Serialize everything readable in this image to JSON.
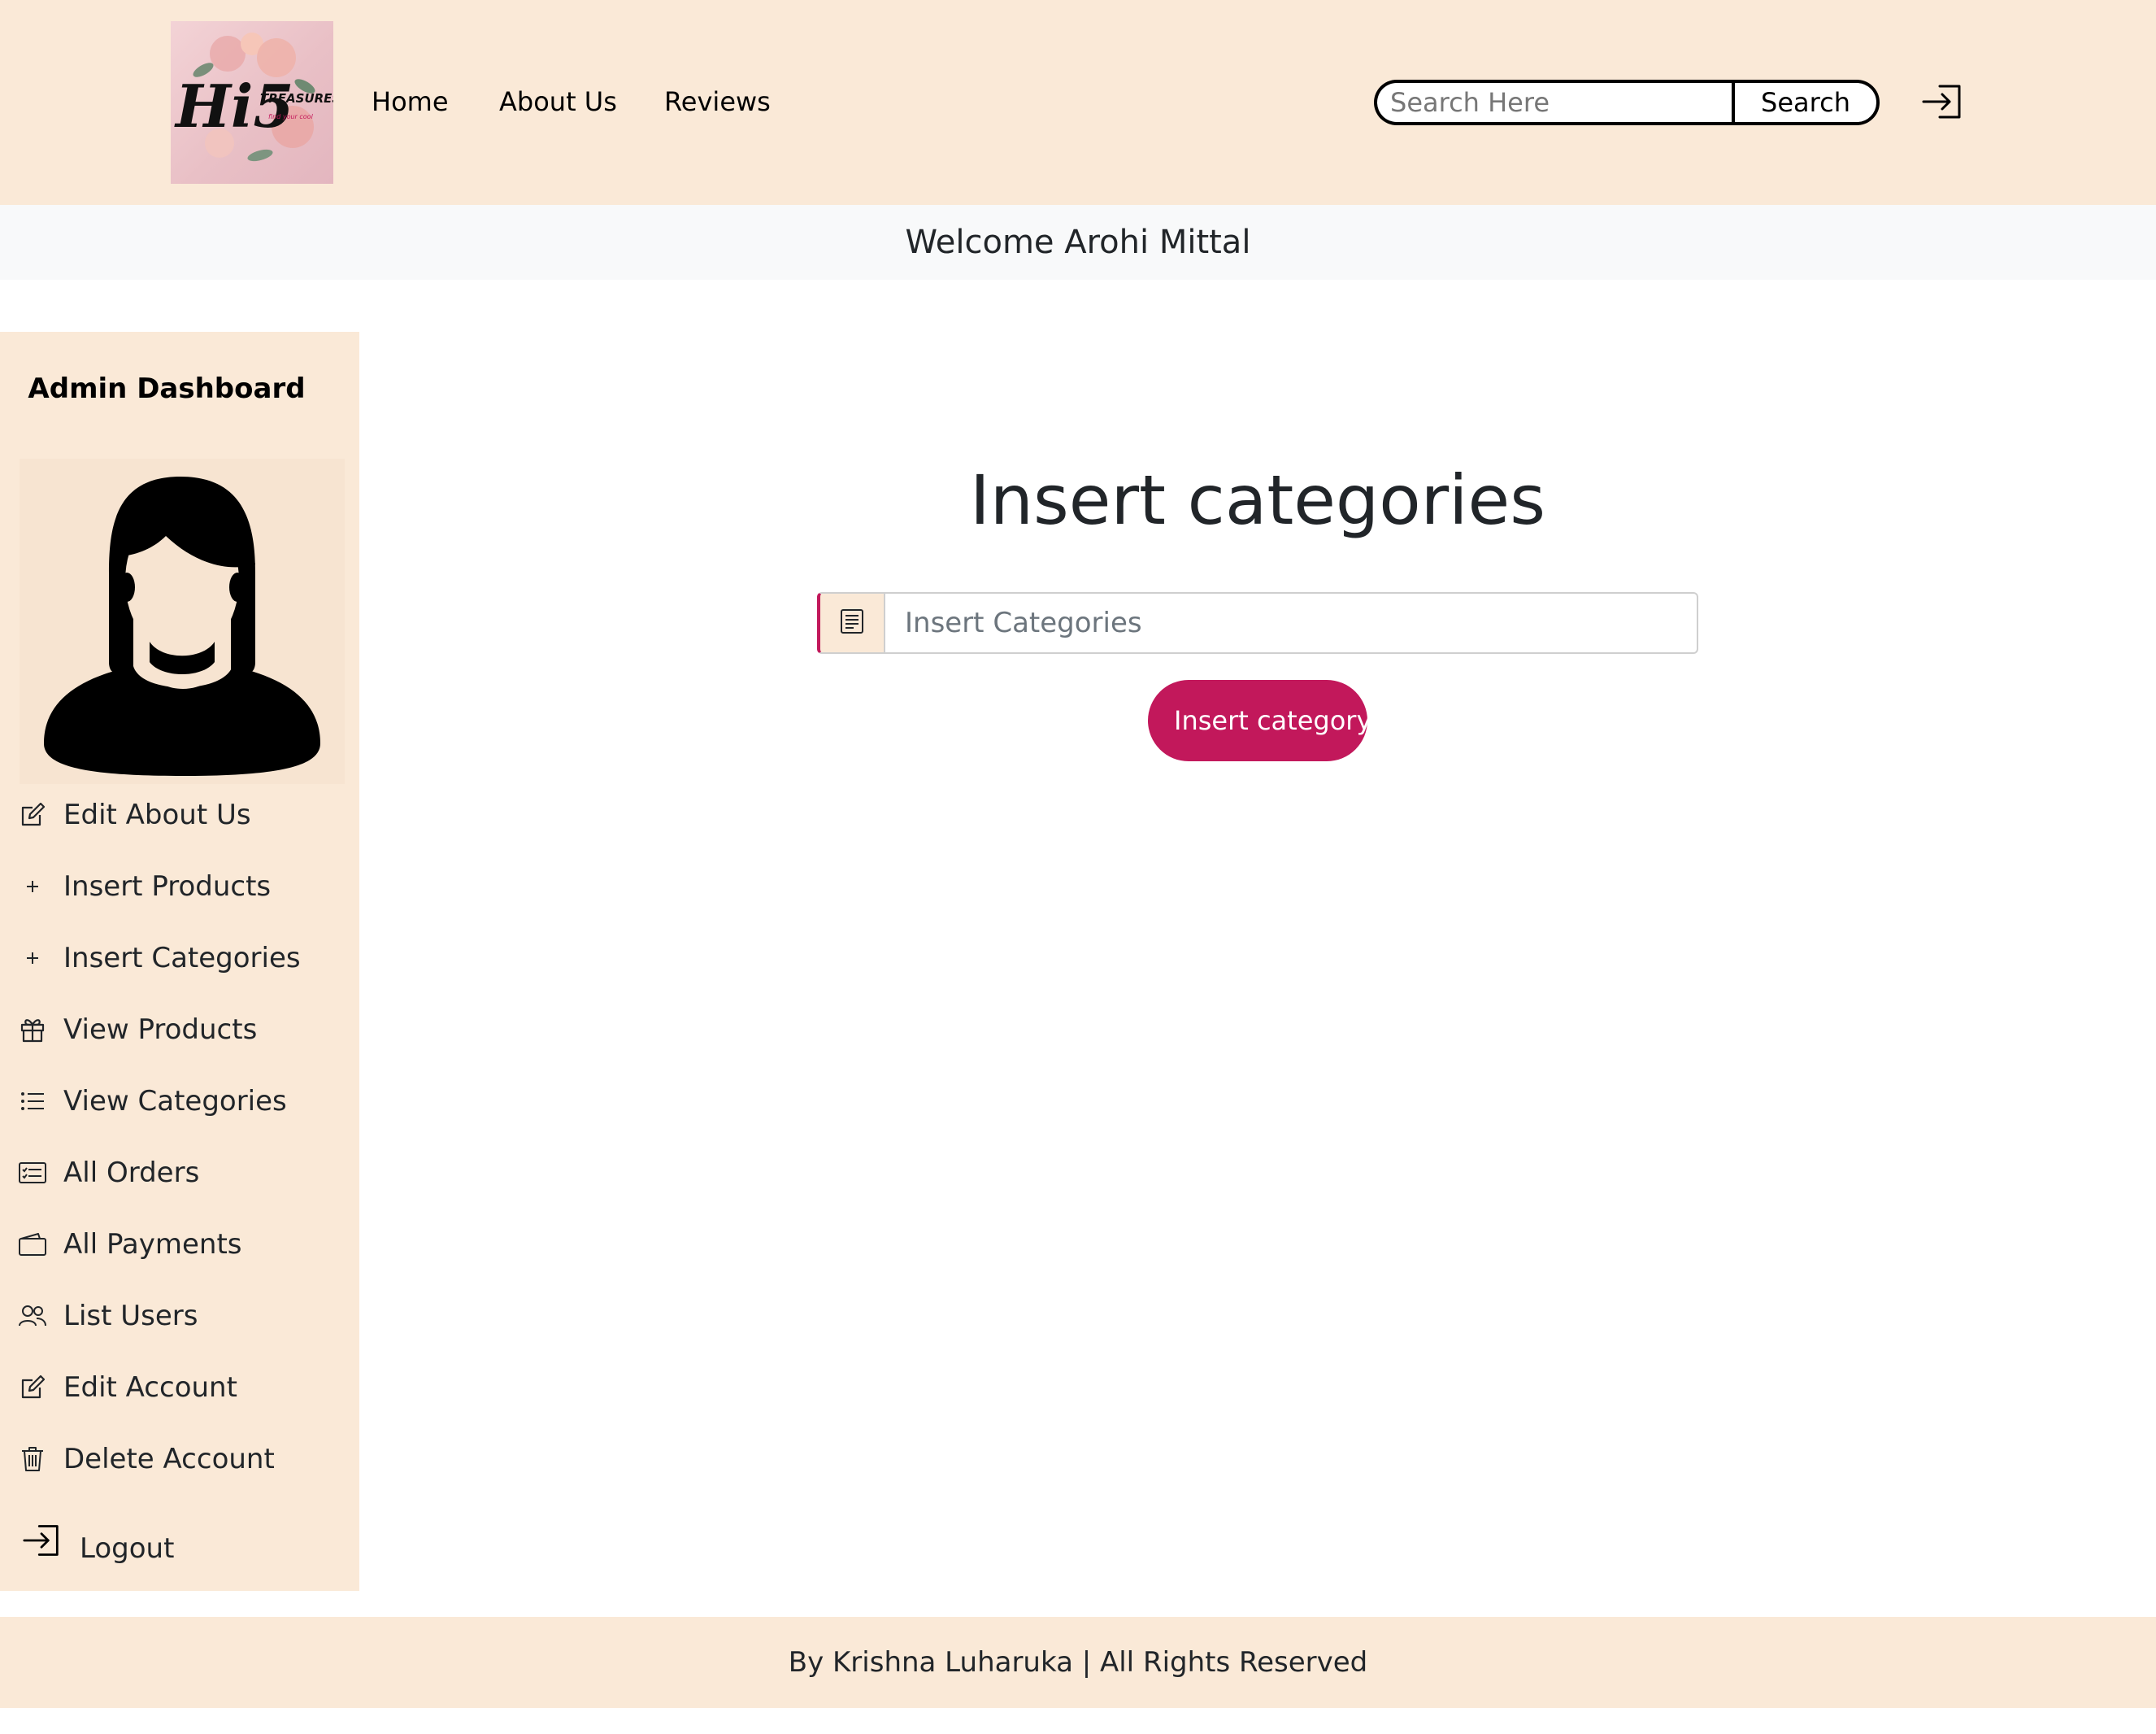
{
  "brand": {
    "logo_text": "Hi5",
    "logo_subtext": "TREASURES",
    "logo_tagline": "find your cool"
  },
  "nav": {
    "links": [
      {
        "label": "Home"
      },
      {
        "label": "About Us"
      },
      {
        "label": "Reviews"
      }
    ]
  },
  "search": {
    "placeholder": "Search Here",
    "button_label": "Search"
  },
  "header": {
    "login_icon": "login-icon"
  },
  "welcome": {
    "text": "Welcome Arohi Mittal"
  },
  "sidebar": {
    "title": "Admin Dashboard",
    "avatar_icon": "female-user-icon",
    "items": [
      {
        "label": "Edit About Us",
        "icon": "edit-icon"
      },
      {
        "label": "Insert Products",
        "icon": "plus-icon"
      },
      {
        "label": "Insert Categories",
        "icon": "plus-icon"
      },
      {
        "label": "View Products",
        "icon": "gift-icon"
      },
      {
        "label": "View Categories",
        "icon": "list-icon"
      },
      {
        "label": "All Orders",
        "icon": "card-list-icon"
      },
      {
        "label": "All Payments",
        "icon": "wallet-icon"
      },
      {
        "label": "List Users",
        "icon": "people-icon"
      },
      {
        "label": "Edit Account",
        "icon": "edit-icon"
      },
      {
        "label": "Delete Account",
        "icon": "trash-icon"
      },
      {
        "label": "Logout",
        "icon": "logout-icon"
      }
    ]
  },
  "main": {
    "title": "Insert categories",
    "input_icon": "receipt-icon",
    "input_placeholder": "Insert Categories",
    "input_value": "",
    "button_label": "Insert category"
  },
  "footer": {
    "text": "By Krishna Luharuka | All Rights Reserved"
  },
  "colors": {
    "header_bg": "#fae9d7",
    "accent": "#c2185b",
    "welcome_bg": "#f8f9fa"
  }
}
